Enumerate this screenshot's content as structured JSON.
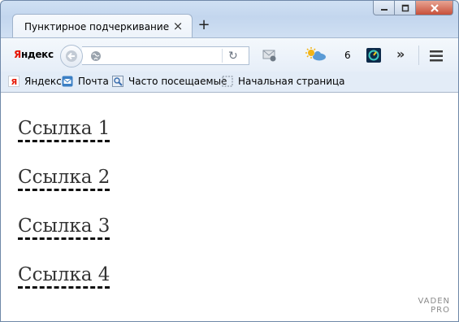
{
  "window": {
    "controls": {
      "minimize": "minimize",
      "maximize": "maximize",
      "close": "close"
    }
  },
  "tab": {
    "title": "Пунктирное подчеркивание",
    "close_glyph": "×",
    "new_tab_glyph": "+"
  },
  "toolbar": {
    "yandex_first": "Я",
    "yandex_rest": "ндекс",
    "url_value": "",
    "reload_glyph": "↻",
    "weather_temp": "6",
    "overflow_glyph": "»",
    "icons": [
      "back-arrow-icon",
      "globe-icon",
      "reload-icon",
      "mail-check-icon",
      "weather-icon",
      "speedtest-icon",
      "overflow-icon",
      "hamburger-menu-icon"
    ]
  },
  "bookmarks": [
    {
      "label": "Яндекс",
      "icon": "yandex-icon"
    },
    {
      "label": "Почта",
      "icon": "mail-icon"
    },
    {
      "label": "Часто посещаемые",
      "icon": "frequent-icon"
    },
    {
      "label": "Начальная страница",
      "icon": "blank-page-icon"
    }
  ],
  "content": {
    "links": [
      "Ссылка 1",
      "Ссылка 2",
      "Ссылка 3",
      "Ссылка 4"
    ],
    "watermark_line1": "VADEN",
    "watermark_line2": "PRO"
  },
  "colors": {
    "link_text": "#333333",
    "dashed_underline": "#111111",
    "yandex_red": "#e61400",
    "close_button": "#c7503a"
  }
}
